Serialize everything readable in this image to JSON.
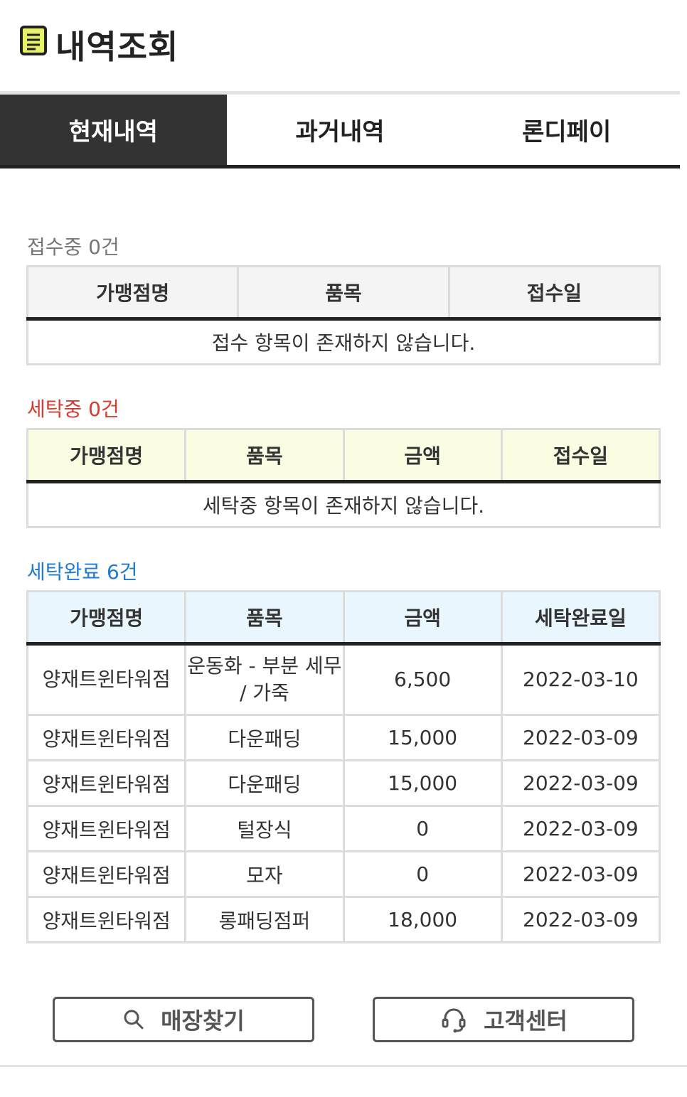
{
  "header": {
    "title": "내역조회",
    "icon": "document-icon"
  },
  "tabs": [
    {
      "label": "현재내역",
      "active": true
    },
    {
      "label": "과거내역",
      "active": false
    },
    {
      "label": "론디페이",
      "active": false
    }
  ],
  "received": {
    "label": "접수중 0건",
    "columns": [
      "가맹점명",
      "품목",
      "접수일"
    ],
    "empty_message": "접수 항목이 존재하지 않습니다."
  },
  "washing": {
    "label": "세탁중 0건",
    "columns": [
      "가맹점명",
      "품목",
      "금액",
      "접수일"
    ],
    "empty_message": "세탁중 항목이 존재하지 않습니다."
  },
  "completed": {
    "label": "세탁완료 6건",
    "columns": [
      "가맹점명",
      "품목",
      "금액",
      "세탁완료일"
    ],
    "rows": [
      {
        "store": "양재트윈타워점",
        "item": "운동화 - 부분 세무 / 가죽",
        "amount": "6,500",
        "date": "2022-03-10"
      },
      {
        "store": "양재트윈타워점",
        "item": "다운패딩",
        "amount": "15,000",
        "date": "2022-03-09"
      },
      {
        "store": "양재트윈타워점",
        "item": "다운패딩",
        "amount": "15,000",
        "date": "2022-03-09"
      },
      {
        "store": "양재트윈타워점",
        "item": "털장식",
        "amount": "0",
        "date": "2022-03-09"
      },
      {
        "store": "양재트윈타워점",
        "item": "모자",
        "amount": "0",
        "date": "2022-03-09"
      },
      {
        "store": "양재트윈타워점",
        "item": "롱패딩점퍼",
        "amount": "18,000",
        "date": "2022-03-09"
      }
    ]
  },
  "buttons": {
    "find_store": {
      "label": "매장찾기",
      "icon": "search-icon"
    },
    "customer_center": {
      "label": "고객센터",
      "icon": "headset-icon"
    }
  },
  "colors": {
    "active_tab": "#333333",
    "washing_label": "#d93a2f",
    "completed_label": "#1e7bd0"
  }
}
